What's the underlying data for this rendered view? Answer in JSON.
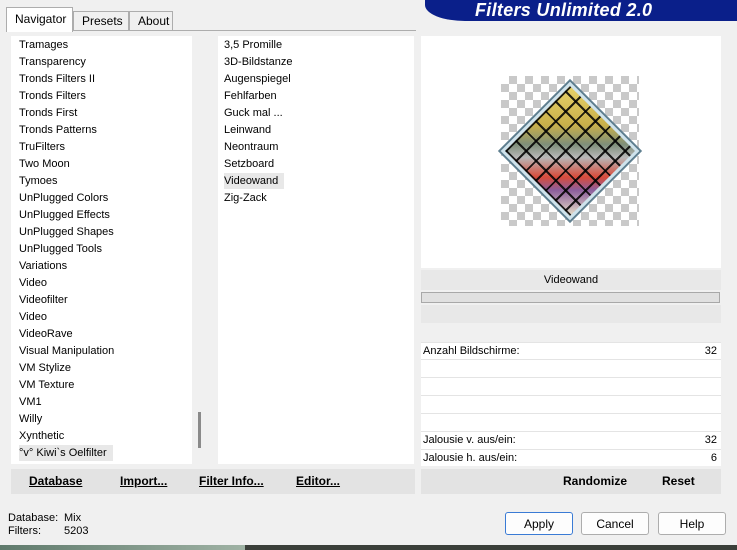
{
  "tabs": [
    {
      "label": "Navigator",
      "active": true
    },
    {
      "label": "Presets",
      "active": false
    },
    {
      "label": "About",
      "active": false
    }
  ],
  "brand": {
    "title": "Filters Unlimited 2.0",
    "color": "#0a1f8a"
  },
  "categories": {
    "items": [
      "Tramages",
      "Transparency",
      "Tronds Filters II",
      "Tronds Filters",
      "Tronds First",
      "Tronds Patterns",
      "TruFilters",
      "Two Moon",
      "Tymoes",
      "UnPlugged Colors",
      "UnPlugged Effects",
      "UnPlugged Shapes",
      "UnPlugged Tools",
      "Variations",
      "Video",
      "Videofilter",
      "Video",
      "VideoRave",
      "Visual Manipulation",
      "VM Stylize",
      "VM Texture",
      "VM1",
      "Willy",
      "Xynthetic",
      "°v° Kiwi`s Oelfilter"
    ],
    "selected_index": 24
  },
  "filters": {
    "items": [
      "3,5 Promille",
      "3D-Bildstanze",
      "Augenspiegel",
      "Fehlfarben",
      "Guck mal ...",
      "Leinwand",
      "Neontraum",
      "Setzboard",
      "Videowand",
      "Zig-Zack"
    ],
    "selected_index": 8
  },
  "commands": [
    "Database",
    "Import...",
    "Filter Info...",
    "Editor..."
  ],
  "preview": {
    "filter_name": "Videowand",
    "progress": 0
  },
  "params": [
    {
      "label": "Anzahl Bildschirme:",
      "value": "32"
    },
    {
      "label": "",
      "value": ""
    },
    {
      "label": "",
      "value": ""
    },
    {
      "label": "",
      "value": ""
    },
    {
      "label": "Jalousie v. aus/ein:",
      "value": "32"
    },
    {
      "label": "Jalousie h. aus/ein:",
      "value": "6"
    }
  ],
  "actions": {
    "randomize": "Randomize",
    "reset": "Reset"
  },
  "status": {
    "database_label": "Database:",
    "database_value": "Mix",
    "filters_label": "Filters:",
    "filters_value": "5203"
  },
  "buttons": {
    "apply": "Apply",
    "cancel": "Cancel",
    "help": "Help"
  }
}
